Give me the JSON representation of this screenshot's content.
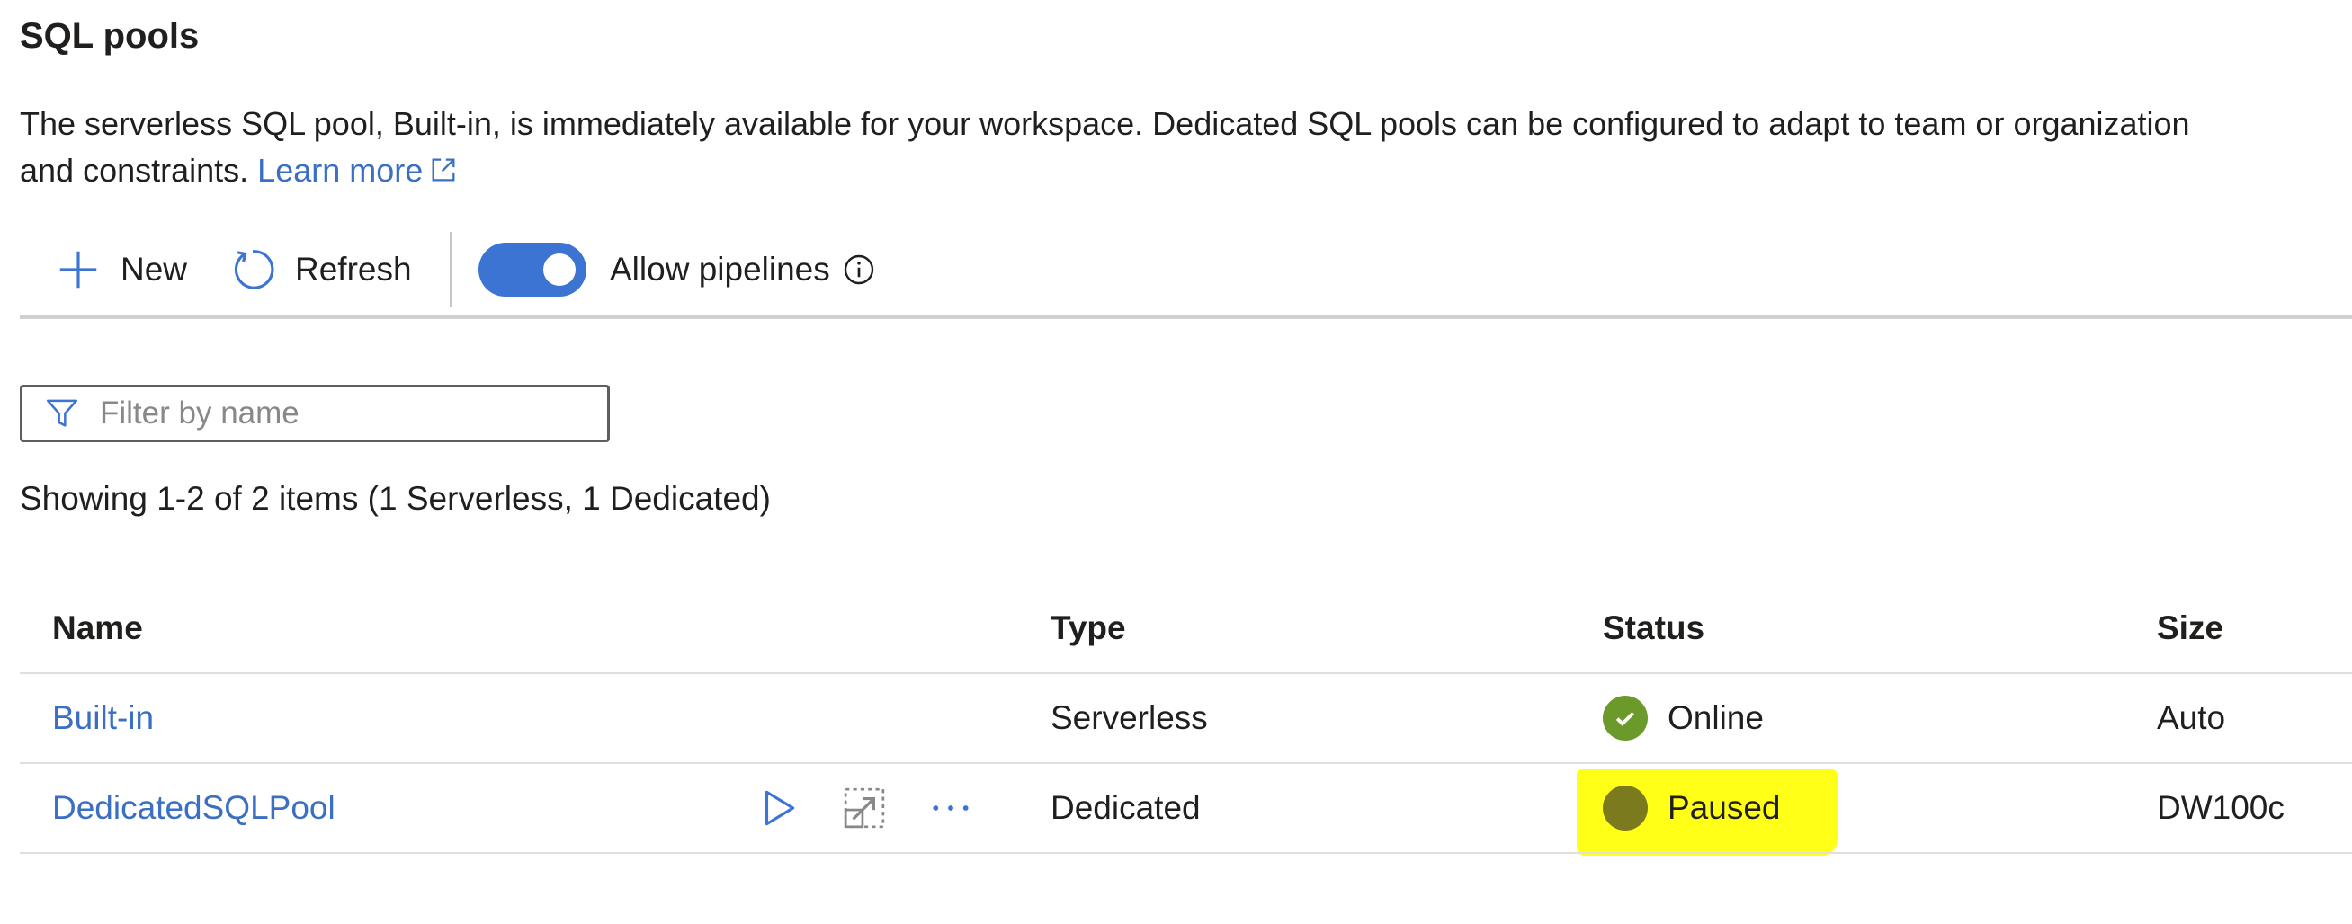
{
  "page": {
    "title": "SQL pools",
    "description_line1": "The serverless SQL pool, Built-in, is immediately available for your workspace. Dedicated SQL pools can be configured to adapt to team or organization",
    "description_line2": "and constraints.",
    "learn_more": "Learn more"
  },
  "toolbar": {
    "new_label": "New",
    "refresh_label": "Refresh",
    "allow_pipelines_label": "Allow pipelines",
    "allow_pipelines_on": true
  },
  "filter": {
    "placeholder": "Filter by name",
    "value": ""
  },
  "summary": "Showing 1-2 of 2 items (1 Serverless, 1 Dedicated)",
  "table": {
    "columns": [
      "Name",
      "Type",
      "Status",
      "Size"
    ],
    "rows": [
      {
        "name": "Built-in",
        "type": "Serverless",
        "status": "Online",
        "size": "Auto"
      },
      {
        "name": "DedicatedSQLPool",
        "type": "Dedicated",
        "status": "Paused",
        "size": "DW100c"
      }
    ]
  },
  "colors": {
    "accent": "#3c74d4",
    "link": "#3a6fc4",
    "status_online": "#6b9a2b",
    "status_paused": "#7b7a1e",
    "highlight": "#ffff17"
  },
  "icons": {
    "new": "plus-icon",
    "refresh": "refresh-icon",
    "info": "info-icon",
    "filter": "filter-icon",
    "external": "external-link-icon",
    "resume": "play-icon",
    "scale": "scale-icon",
    "more": "more-icon",
    "online": "check-circle-icon",
    "paused": "paused-circle-icon"
  }
}
